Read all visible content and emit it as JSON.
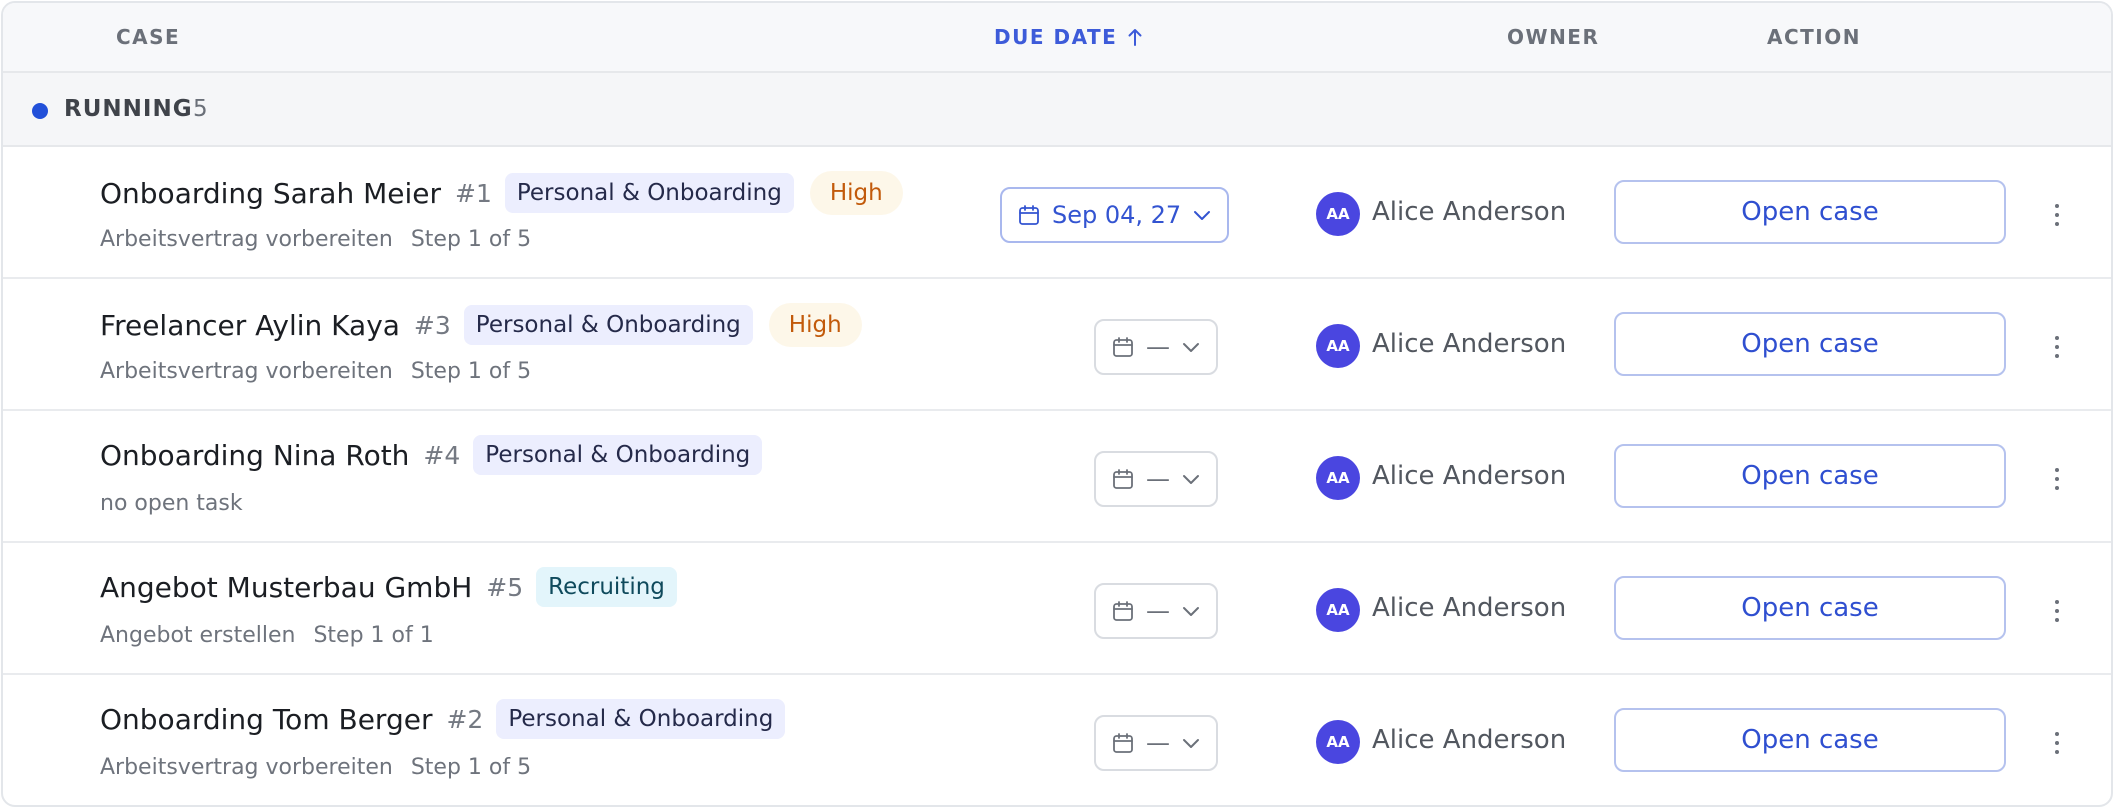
{
  "header": {
    "case": "CASE",
    "due_date": "DUE DATE",
    "owner": "OWNER",
    "action": "ACTION"
  },
  "group": {
    "label": "RUNNING",
    "count": "5",
    "color": "#2250d9"
  },
  "rows": [
    {
      "title": "Onboarding Sarah Meier",
      "number": "#1",
      "tag": "Personal & Onboarding",
      "priority": "High",
      "task": "Arbeitsvertrag vorbereiten",
      "step": "Step 1 of 5",
      "due": "Sep 04, 27",
      "owner_initials": "AA",
      "owner": "Alice Anderson",
      "action": "Open case"
    },
    {
      "title": "Freelancer Aylin Kaya",
      "number": "#3",
      "tag": "Personal & Onboarding",
      "priority": "High",
      "task": "Arbeitsvertrag vorbereiten",
      "step": "Step 1 of 5",
      "due": "—",
      "owner_initials": "AA",
      "owner": "Alice Anderson",
      "action": "Open case"
    },
    {
      "title": "Onboarding Nina Roth",
      "number": "#4",
      "tag": "Personal & Onboarding",
      "task": "no open task",
      "due": "—",
      "owner_initials": "AA",
      "owner": "Alice Anderson",
      "action": "Open case"
    },
    {
      "title": "Angebot Musterbau GmbH",
      "number": "#5",
      "tag": "Recruiting",
      "task": "Angebot erstellen",
      "step": "Step 1 of 1",
      "due": "—",
      "owner_initials": "AA",
      "owner": "Alice Anderson",
      "action": "Open case"
    },
    {
      "title": "Onboarding Tom Berger",
      "number": "#2",
      "tag": "Personal & Onboarding",
      "task": "Arbeitsvertrag vorbereiten",
      "step": "Step 1 of 5",
      "due": "—",
      "owner_initials": "AA",
      "owner": "Alice Anderson",
      "action": "Open case"
    }
  ]
}
